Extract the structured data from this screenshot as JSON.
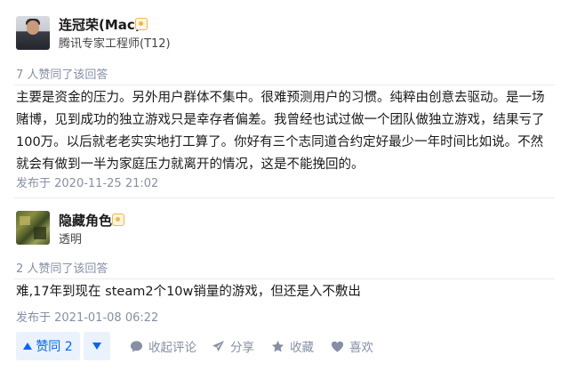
{
  "answers": [
    {
      "author": {
        "name": "连冠荣(Mac)",
        "description": "腾讯专家工程师(T12)"
      },
      "votes_text": "7 人赞同了该回答",
      "content": "主要是资金的压力。另外用户群体不集中。很难预测用户的习惯。纯粹由创意去驱动。是一场赌博，见到成功的独立游戏只是幸存者偏差。我曾经也试过做一个团队做独立游戏，结果亏了100万。以后就老老实实地打工算了。你好有三个志同道合约定好最少一年时间比如说。不然就会有做到一半为家庭压力就离开的情况，这是不能挽回的。",
      "published": "发布于 2020-11-25 21:02"
    },
    {
      "author": {
        "name": "隐藏角色",
        "description": "透明"
      },
      "votes_text": "2 人赞同了该回答",
      "content": "难,17年到现在 steam2个10w销量的游戏，但还是入不敷出",
      "published": "发布于 2021-01-08 06:22"
    }
  ],
  "actions": {
    "vote_up_label": "赞同 2",
    "comment_label": "收起评论",
    "share_label": "分享",
    "collect_label": "收藏",
    "like_label": "喜欢"
  },
  "icons": {
    "vote_up": "triangle-up-icon",
    "vote_down": "triangle-down-icon",
    "comment": "comment-bubble-icon",
    "share": "paper-plane-icon",
    "collect": "star-icon",
    "like": "heart-icon",
    "badge": "certified-badge-icon"
  },
  "colors": {
    "accent": "#0066ff",
    "vote_bg": "#eaf2fd",
    "meta_text": "#8590a6",
    "badge": "#f3b54a"
  }
}
